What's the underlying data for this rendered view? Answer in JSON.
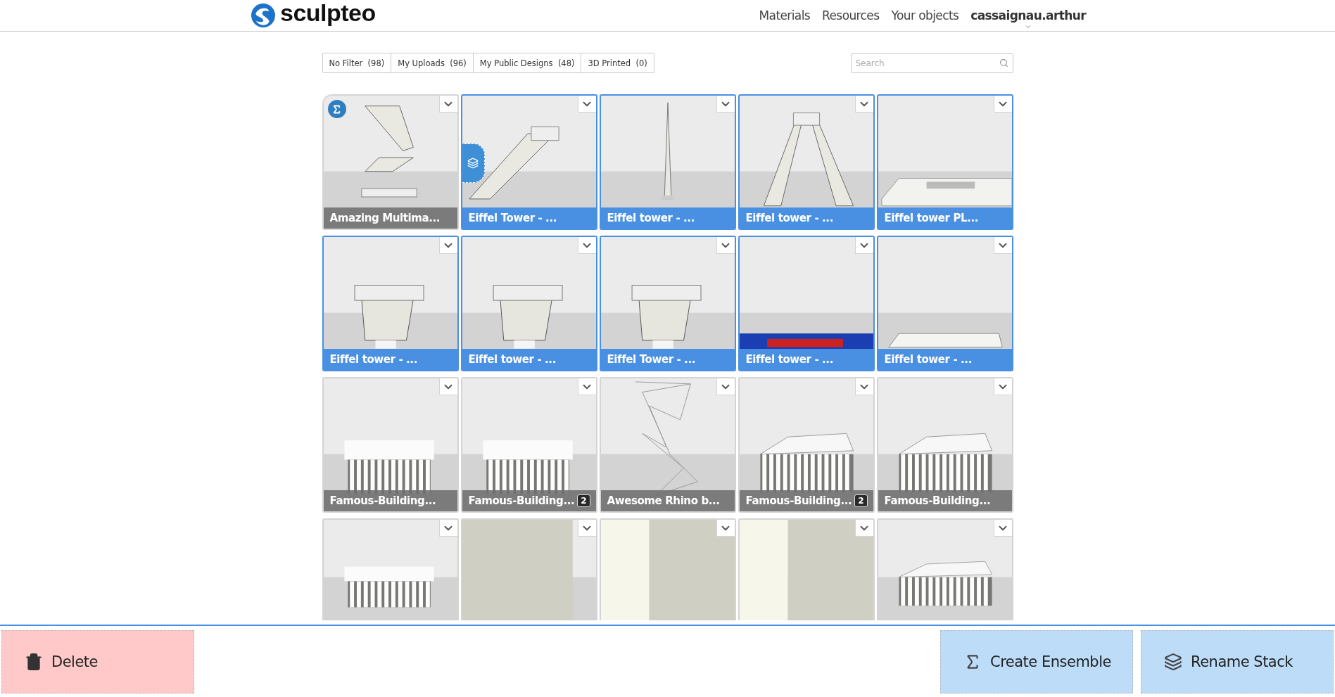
{
  "header": {
    "logo": "sculpteo",
    "nav": [
      {
        "label": "Materials"
      },
      {
        "label": "Resources"
      },
      {
        "label": "Your objects"
      }
    ],
    "user": "cassaignau.arthur"
  },
  "filters": [
    {
      "label": "No Filter  (98)"
    },
    {
      "label": "My Uploads  (96)"
    },
    {
      "label": "My Public Designs  (48)"
    },
    {
      "label": "3D Printed  (0)"
    }
  ],
  "search": {
    "placeholder": "Search"
  },
  "tiles": [
    {
      "title": "Amazing Multima...",
      "selected": false,
      "ensemble": true
    },
    {
      "title": "Eiffel Tower - ...",
      "selected": true,
      "stacked": true
    },
    {
      "title": "Eiffel tower - ...",
      "selected": true
    },
    {
      "title": "Eiffel tower - ...",
      "selected": true
    },
    {
      "title": "Eiffel tower PL...",
      "selected": true
    },
    {
      "title": "Eiffel tower - ...",
      "selected": true
    },
    {
      "title": "Eiffel tower - ...",
      "selected": true
    },
    {
      "title": "Eiffel Tower - ...",
      "selected": true
    },
    {
      "title": "Eiffel tower - ...",
      "selected": true
    },
    {
      "title": "Eiffel tower - ...",
      "selected": true
    },
    {
      "title": "Famous-Building...",
      "selected": false
    },
    {
      "title": "Famous-Building...",
      "selected": false,
      "badge": "2"
    },
    {
      "title": "Awesome Rhino b...",
      "selected": false
    },
    {
      "title": "Famous-Building...",
      "selected": false,
      "badge": "2"
    },
    {
      "title": "Famous-Building...",
      "selected": false
    },
    {
      "selected": false
    },
    {
      "selected": false
    },
    {
      "selected": false
    },
    {
      "selected": false
    },
    {
      "selected": false
    }
  ],
  "actions": [
    {
      "kind": "delete",
      "label": "Delete"
    },
    {
      "kind": "ensemble",
      "label": "Create Ensemble"
    },
    {
      "kind": "stack",
      "label": "Rename Stack"
    }
  ]
}
